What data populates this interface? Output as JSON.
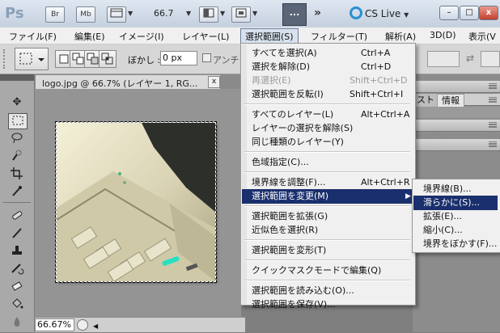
{
  "app": {
    "logo": "Ps",
    "toolbar_icons": [
      "Br",
      "Mb"
    ],
    "zoom": "66.7",
    "more": "...",
    "cs_live": "CS Live"
  },
  "menubar": [
    {
      "label": "ファイル(F)"
    },
    {
      "label": "編集(E)"
    },
    {
      "label": "イメージ(I)"
    },
    {
      "label": "レイヤー(L)"
    },
    {
      "label": "選択範囲(S)",
      "active": true
    },
    {
      "label": "フィルター(T)"
    },
    {
      "label": "解析(A)"
    },
    {
      "label": "3D(D)"
    },
    {
      "label": "表示(V"
    }
  ],
  "options": {
    "feather_label": "ぼかし :",
    "feather_value": "0 px",
    "antialias_label": "アンチ"
  },
  "document": {
    "tab_title": "logo.jpg @ 66.7% (レイヤー 1, RG...",
    "status_zoom": "66.67%"
  },
  "panels": {
    "tab_partial": "スト",
    "tab_info": "情報"
  },
  "select_menu": {
    "items": [
      {
        "label": "すべてを選択(A)",
        "shortcut": "Ctrl+A"
      },
      {
        "label": "選択を解除(D)",
        "shortcut": "Ctrl+D"
      },
      {
        "label": "再選択(E)",
        "shortcut": "Shift+Ctrl+D",
        "disabled": true
      },
      {
        "label": "選択範囲を反転(I)",
        "shortcut": "Shift+Ctrl+I"
      },
      {
        "sep": true
      },
      {
        "label": "すべてのレイヤー(L)",
        "shortcut": "Alt+Ctrl+A"
      },
      {
        "label": "レイヤーの選択を解除(S)",
        "shortcut": ""
      },
      {
        "label": "同じ種類のレイヤー(Y)",
        "shortcut": ""
      },
      {
        "sep": true
      },
      {
        "label": "色域指定(C)...",
        "shortcut": ""
      },
      {
        "sep": true
      },
      {
        "label": "境界線を調整(F)...",
        "shortcut": "Alt+Ctrl+R"
      },
      {
        "label": "選択範囲を変更(M)",
        "shortcut": "",
        "submenu": true,
        "highlighted": true
      },
      {
        "sep": true
      },
      {
        "label": "選択範囲を拡張(G)",
        "shortcut": ""
      },
      {
        "label": "近似色を選択(R)",
        "shortcut": ""
      },
      {
        "sep": true
      },
      {
        "label": "選択範囲を変形(T)",
        "shortcut": ""
      },
      {
        "sep": true
      },
      {
        "label": "クイックマスクモードで編集(Q)",
        "shortcut": ""
      },
      {
        "sep": true
      },
      {
        "label": "選択範囲を読み込む(O)...",
        "shortcut": ""
      },
      {
        "label": "選択範囲を保存(V)...",
        "shortcut": ""
      }
    ]
  },
  "modify_submenu": {
    "items": [
      {
        "label": "境界線(B)..."
      },
      {
        "label": "滑らかに(S)...",
        "highlighted": true
      },
      {
        "label": "拡張(E)..."
      },
      {
        "label": "縮小(C)..."
      },
      {
        "label": "境界をぼかす(F)..."
      }
    ]
  },
  "colors": {
    "highlight": "#1a2f6d",
    "menu_bg": "#f0f0f0"
  }
}
